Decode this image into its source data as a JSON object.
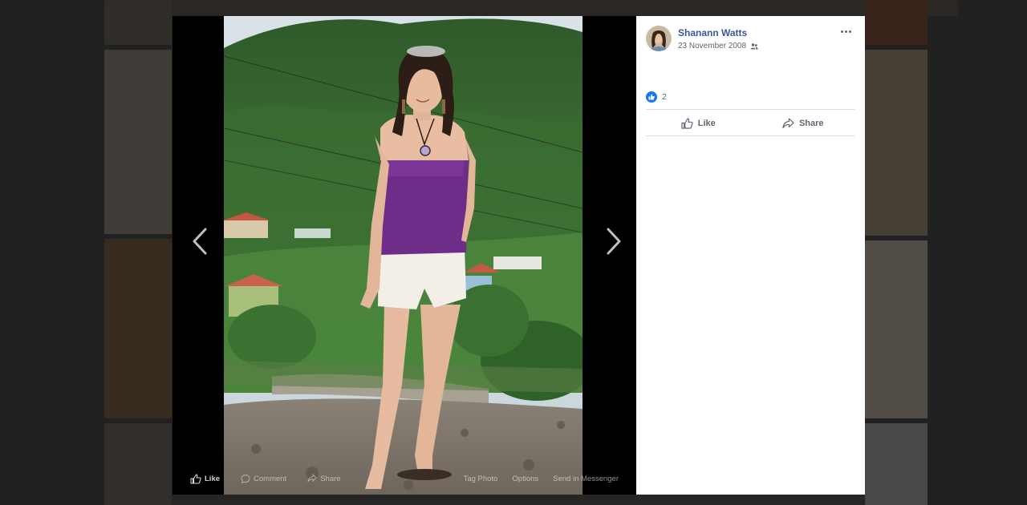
{
  "viewer": {
    "prev_arrow_icon": "chevron-left-icon",
    "next_arrow_icon": "chevron-right-icon",
    "photo_actions": {
      "like": "Like",
      "comment": "Comment",
      "share": "Share",
      "tag_photo": "Tag Photo",
      "options": "Options",
      "send_messenger": "Send in Messenger"
    }
  },
  "post": {
    "author": "Shanann Watts",
    "date": "23 November 2008",
    "audience_icon": "friends-icon",
    "reaction_count": "2",
    "actions": {
      "like": "Like",
      "share": "Share"
    }
  },
  "colors": {
    "link": "#385898",
    "like_blue": "#1877f2",
    "secondary_text": "#606770"
  }
}
